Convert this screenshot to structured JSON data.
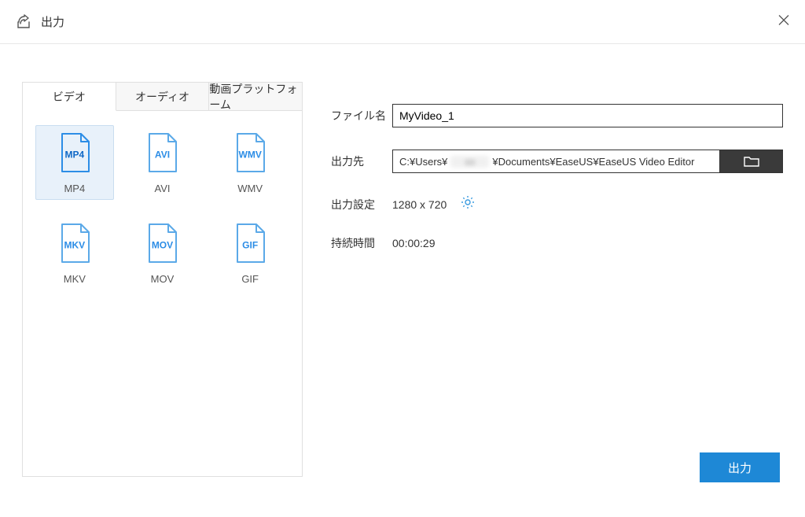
{
  "header": {
    "title": "出力"
  },
  "tabs": [
    {
      "label": "ビデオ",
      "active": true
    },
    {
      "label": "オーディオ",
      "active": false
    },
    {
      "label": "動画プラットフォーム",
      "active": false
    }
  ],
  "formats": [
    {
      "code": "MP4",
      "label": "MP4",
      "selected": true
    },
    {
      "code": "AVI",
      "label": "AVI",
      "selected": false
    },
    {
      "code": "WMV",
      "label": "WMV",
      "selected": false
    },
    {
      "code": "MKV",
      "label": "MKV",
      "selected": false
    },
    {
      "code": "MOV",
      "label": "MOV",
      "selected": false
    },
    {
      "code": "GIF",
      "label": "GIF",
      "selected": false
    }
  ],
  "fields": {
    "filename_label": "ファイル名",
    "filename_value": "MyVideo_1",
    "output_path_label": "出力先",
    "output_path_prefix": "C:¥Users¥",
    "output_path_suffix": "¥Documents¥EaseUS¥EaseUS Video Editor",
    "output_settings_label": "出力設定",
    "output_settings_value": "1280 x 720",
    "duration_label": "持続時間",
    "duration_value": "00:00:29"
  },
  "buttons": {
    "export": "出力"
  }
}
